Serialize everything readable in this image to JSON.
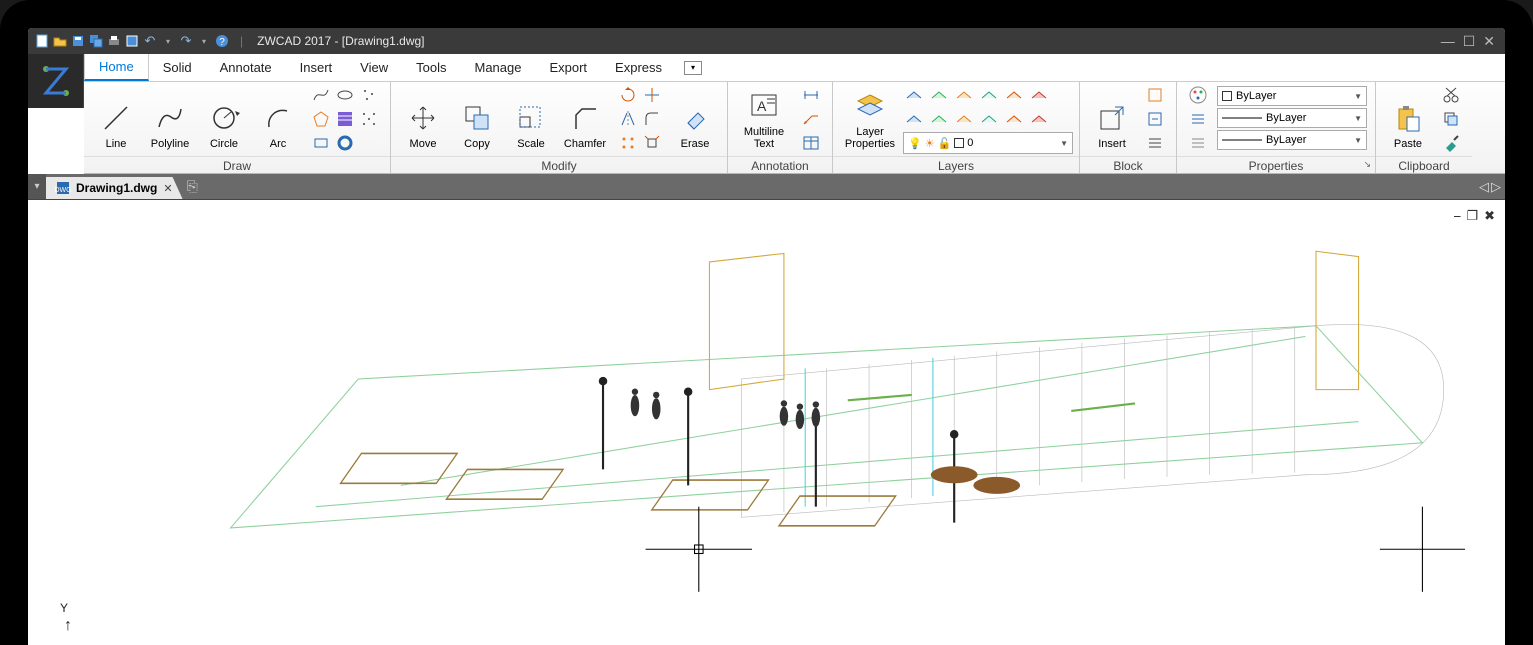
{
  "app": {
    "title": "ZWCAD 2017 - [Drawing1.dwg]"
  },
  "menubar": {
    "items": [
      "Home",
      "Solid",
      "Annotate",
      "Insert",
      "View",
      "Tools",
      "Manage",
      "Export",
      "Express"
    ],
    "active": "Home"
  },
  "ribbon": {
    "panels": [
      {
        "id": "draw",
        "label": "Draw",
        "bigButtons": [
          {
            "id": "line",
            "label": "Line",
            "icon": "line"
          },
          {
            "id": "polyline",
            "label": "Polyline",
            "icon": "polyline"
          },
          {
            "id": "circle",
            "label": "Circle",
            "icon": "circle"
          },
          {
            "id": "arc",
            "label": "Arc",
            "icon": "arc"
          }
        ],
        "smallButtons": [
          "spline",
          "ellipse",
          "dots",
          "polygon",
          "hatch",
          "dots2",
          "rect",
          "ring"
        ]
      },
      {
        "id": "modify",
        "label": "Modify",
        "bigButtons": [
          {
            "id": "move",
            "label": "Move",
            "icon": "move"
          },
          {
            "id": "copy",
            "label": "Copy",
            "icon": "copy"
          },
          {
            "id": "scale",
            "label": "Scale",
            "icon": "scale"
          },
          {
            "id": "chamfer",
            "label": "Chamfer",
            "icon": "chamfer"
          }
        ],
        "smallButtons": [
          "rotate",
          "trim",
          "mirror",
          "fillet",
          "arr1",
          "arr2"
        ],
        "eraseLabel": "Erase"
      },
      {
        "id": "annotation",
        "label": "Annotation",
        "bigButtons": [
          {
            "id": "multiline-text",
            "label": "Multiline\nText",
            "icon": "text"
          }
        ],
        "smallButtons": [
          "dim",
          "leader",
          "table"
        ]
      },
      {
        "id": "layers",
        "label": "Layers",
        "bigButtons": [
          {
            "id": "layer-properties",
            "label": "Layer\nProperties",
            "icon": "layers"
          }
        ],
        "comboValue": "0"
      },
      {
        "id": "block",
        "label": "Block",
        "bigButtons": [
          {
            "id": "insert",
            "label": "Insert",
            "icon": "insert"
          }
        ]
      },
      {
        "id": "properties",
        "label": "Properties",
        "combos": [
          "ByLayer",
          "ByLayer",
          "ByLayer"
        ]
      },
      {
        "id": "clipboard",
        "label": "Clipboard",
        "bigButtons": [
          {
            "id": "paste",
            "label": "Paste",
            "icon": "paste"
          }
        ]
      }
    ]
  },
  "docTabs": {
    "tabs": [
      {
        "name": "Drawing1.dwg"
      }
    ]
  },
  "axis": {
    "y": "Y"
  }
}
